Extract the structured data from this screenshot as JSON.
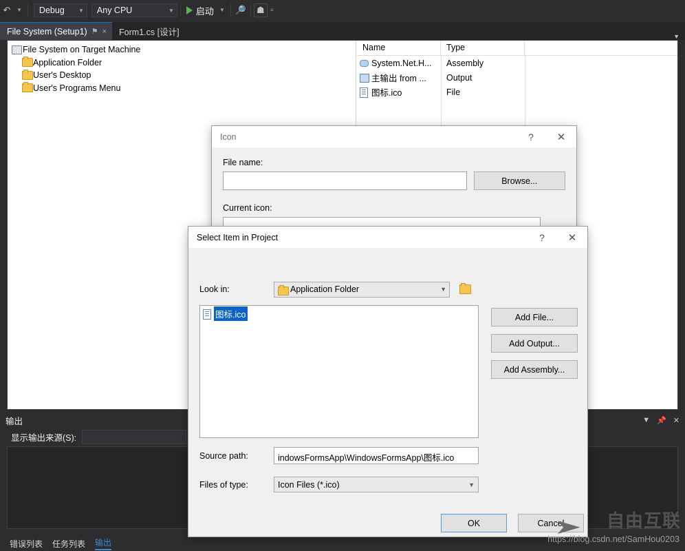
{
  "toolbar": {
    "back_icon": "back-arrow-icon",
    "configuration": "Debug",
    "platform": "Any CPU",
    "run_label": "启动",
    "search_icon": "search-icon",
    "home_icon": "home-icon",
    "overflow_icon": "toolbar-overflow-icon"
  },
  "tabs": {
    "items": [
      {
        "label": "File System (Setup1)",
        "active": true,
        "pin": "⚑",
        "close": "×"
      },
      {
        "label": "Form1.cs [设计]",
        "active": false
      }
    ],
    "overflow": "▼"
  },
  "designer": {
    "tree": [
      {
        "label": "File System on Target Machine",
        "icon": "computer-icon",
        "indent": 0
      },
      {
        "label": "Application Folder",
        "icon": "folder-icon",
        "indent": 1
      },
      {
        "label": "User's Desktop",
        "icon": "folder-icon",
        "indent": 1
      },
      {
        "label": "User's Programs Menu",
        "icon": "folder-icon",
        "indent": 1
      }
    ],
    "columns": [
      "Name",
      "Type",
      ""
    ],
    "rows": [
      {
        "name": "System.Net.H...",
        "type": "Assembly",
        "icon": "assembly-icon"
      },
      {
        "name": "主输出 from ...",
        "type": "Output",
        "icon": "output-icon"
      },
      {
        "name": "图标.ico",
        "type": "File",
        "icon": "file-icon"
      }
    ]
  },
  "output_panel": {
    "title": "输出",
    "dropdown_icon": "chevron-down-icon",
    "pin_icon": "pin-icon",
    "close_icon": "close-icon",
    "source_label": "显示输出来源(S):",
    "source_value": ""
  },
  "bottom_tabs": {
    "items": [
      "错误列表",
      "任务列表",
      "输出"
    ],
    "selected": "输出"
  },
  "icon_dialog": {
    "title": "Icon",
    "help_icon": "?",
    "close_icon": "✕",
    "file_name_label": "File name:",
    "file_name_value": "",
    "browse_label": "Browse...",
    "current_icon_label": "Current icon:"
  },
  "select_dialog": {
    "title": "Select Item in Project",
    "help_icon": "?",
    "close_icon": "✕",
    "look_in_label": "Look in:",
    "look_in_value": "Application Folder",
    "look_in_icon": "folder-icon",
    "up_folder_icon": "up-one-level-icon",
    "files": [
      {
        "name": "图标.ico",
        "icon": "file-icon",
        "selected": true
      }
    ],
    "buttons": {
      "add_file": "Add File...",
      "add_output": "Add Output...",
      "add_assembly": "Add Assembly..."
    },
    "source_path_label": "Source path:",
    "source_path_value": "indowsFormsApp\\WindowsFormsApp\\图标.ico",
    "files_of_type_label": "Files of type:",
    "files_of_type_value": "Icon Files (*.ico)",
    "ok_label": "OK",
    "cancel_label": "Cancel"
  },
  "watermark": {
    "logo": "自由互联",
    "url": "https://blog.csdn.net/SamHou0203"
  },
  "colors": {
    "vs_chrome": "#2d2d30",
    "tab_active": "#3f3f46",
    "accent": "#007acc",
    "selection": "#0a64c8",
    "dialog_face": "#f0f0f0"
  }
}
